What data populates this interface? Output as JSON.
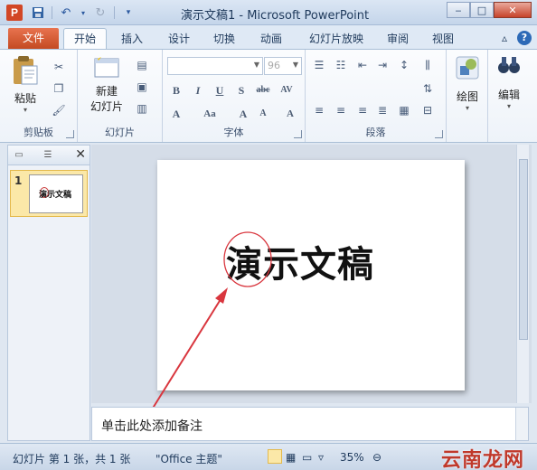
{
  "window": {
    "title": "演示文稿1  -  Microsoft PowerPoint",
    "app_icon": "P",
    "controls": [
      "minimize-icon",
      "maximize-icon",
      "close-icon"
    ]
  },
  "quick_access": [
    "save-icon",
    "undo-icon",
    "redo-icon",
    "customize-icon"
  ],
  "tabs": {
    "file": "文件",
    "items": [
      "开始",
      "插入",
      "设计",
      "切换",
      "动画",
      "幻灯片放映",
      "审阅",
      "视图"
    ],
    "active": "开始"
  },
  "ribbon": {
    "clipboard": {
      "paste": "粘贴",
      "label": "剪贴板"
    },
    "slides": {
      "new_slide_line1": "新建",
      "new_slide_line2": "幻灯片",
      "label": "幻灯片"
    },
    "font": {
      "font_name": "",
      "font_size": "96",
      "label": "字体"
    },
    "paragraph": {
      "label": "段落"
    },
    "drawing": {
      "label": "绘图"
    },
    "editing": {
      "label": "编辑"
    }
  },
  "left_panel": {
    "slide_number": "1",
    "thumbnail_text": "演示文稿"
  },
  "slide": {
    "title": "演示文稿",
    "annotation_color": "#d9363e"
  },
  "notes": {
    "placeholder": "单击此处添加备注"
  },
  "status": {
    "slide_info": "幻灯片 第 1 张，共 1 张",
    "theme": "\"Office 主题\"",
    "zoom": "35%"
  },
  "watermark": "云南龙网"
}
